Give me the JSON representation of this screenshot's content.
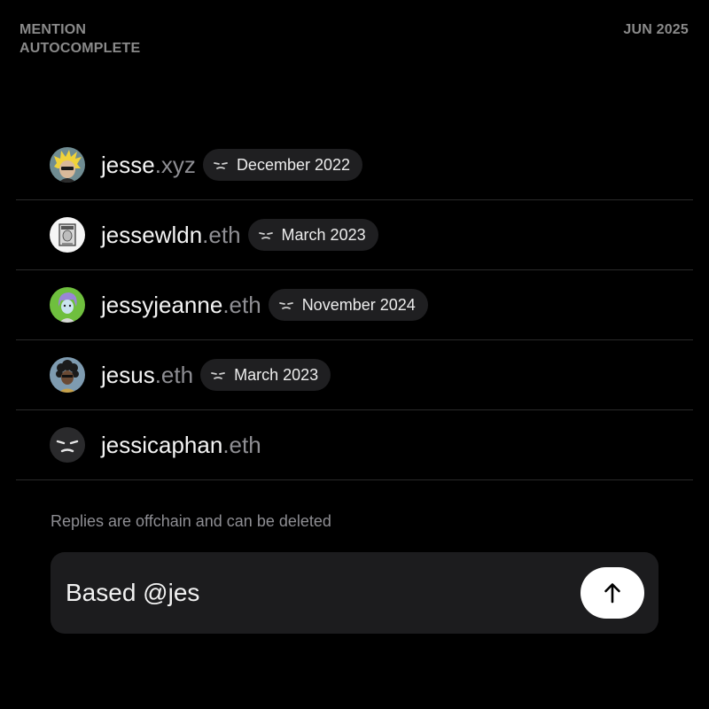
{
  "header": {
    "title_line1": "MENTION",
    "title_line2": "AUTOCOMPLETE",
    "date": "JUN 2025"
  },
  "suggestions": [
    {
      "name": "jesse",
      "suffix": ".xyz",
      "joined": "December 2022",
      "avatar_icon": "blond-character-avatar-icon"
    },
    {
      "name": "jessewldn",
      "suffix": ".eth",
      "joined": "March 2023",
      "avatar_icon": "sketch-portrait-avatar-icon"
    },
    {
      "name": "jessyjeanne",
      "suffix": ".eth",
      "joined": "November 2024",
      "avatar_icon": "purple-hair-character-avatar-icon"
    },
    {
      "name": "jesus",
      "suffix": ".eth",
      "joined": "March 2023",
      "avatar_icon": "curly-hair-character-avatar-icon"
    },
    {
      "name": "jessicaphan",
      "suffix": ".eth",
      "joined": "",
      "avatar_icon": "sleepy-face-avatar-icon"
    }
  ],
  "disclaimer": "Replies are offchain and can be deleted",
  "composer": {
    "value": "Based @jes",
    "send_icon": "arrow-up-icon"
  },
  "colors": {
    "background": "#000000",
    "pill": "#1f1f21",
    "composer": "#1c1c1e",
    "muted_text": "#8e8e93",
    "send_button": "#ffffff"
  }
}
